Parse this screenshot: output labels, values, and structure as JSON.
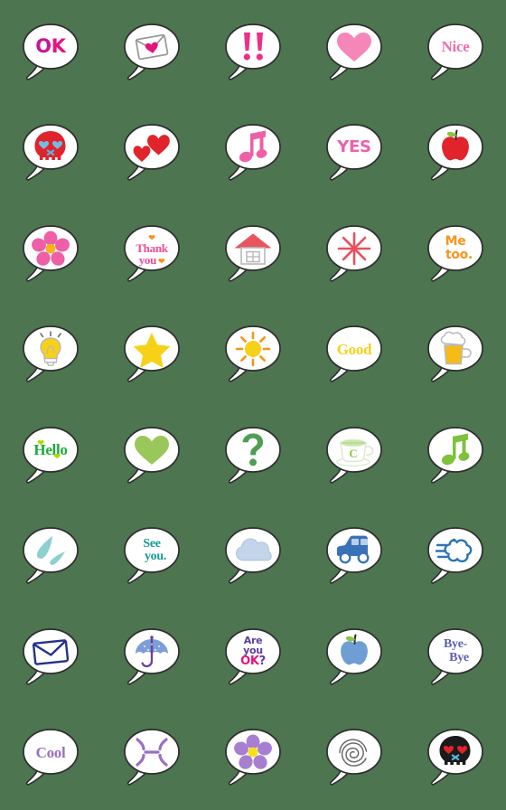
{
  "page": {
    "title": "Speech Bubble Emoji Sticker Set",
    "background_color": "#4c7550",
    "bubble_fill": "#ffffff",
    "bubble_outline": "#3a3a3a",
    "columns": 5,
    "rows": 8,
    "total_items": 40
  },
  "palette": {
    "magenta": "#c2189f",
    "pink": "#ee5fa7",
    "pink_light": "#f06eaa",
    "red": "#e1232b",
    "orange": "#f7941e",
    "yellow": "#f7d117",
    "green": "#1eaa39",
    "green_light": "#9ac75a",
    "green_apple": "#8cc63f",
    "teal": "#149b92",
    "teal_light": "#8ecfd0",
    "blue": "#3a72b8",
    "navy": "#23318c",
    "purple": "#9b6fc0",
    "violet": "#5b3fa0",
    "indigo": "#5b5fb0",
    "gray": "#9a9a9a",
    "black": "#1b1b1b"
  },
  "items": [
    {
      "row": 1,
      "col": 1,
      "name": "ok-bubble",
      "kind": "text",
      "text": "OK",
      "color": "#c2189f",
      "style": "lbl-ok"
    },
    {
      "row": 1,
      "col": 2,
      "name": "envelope-heart-bubble",
      "kind": "icon",
      "icon": "envelope-heart-icon",
      "color": "#9a9a9a",
      "accent": "#e4147d"
    },
    {
      "row": 1,
      "col": 3,
      "name": "double-exclamation-bubble",
      "kind": "icon",
      "icon": "double-exclamation-icon",
      "color": "#ee2e8a"
    },
    {
      "row": 1,
      "col": 4,
      "name": "pink-heart-bubble",
      "kind": "icon",
      "icon": "heart-icon",
      "color": "#f586b8"
    },
    {
      "row": 1,
      "col": 5,
      "name": "nice-bubble",
      "kind": "text",
      "text": "Nice",
      "color": "#f06eaa",
      "style": "lbl-nice"
    },
    {
      "row": 2,
      "col": 1,
      "name": "red-skull-bubble",
      "kind": "icon",
      "icon": "skull-heart-eyes-icon",
      "color": "#e1232b",
      "accent": "#6fbde0"
    },
    {
      "row": 2,
      "col": 2,
      "name": "two-hearts-bubble",
      "kind": "icon",
      "icon": "two-hearts-icon",
      "color": "#e1232b"
    },
    {
      "row": 2,
      "col": 3,
      "name": "pink-music-note-bubble",
      "kind": "icon",
      "icon": "music-note-icon",
      "color": "#ee5fa7"
    },
    {
      "row": 2,
      "col": 4,
      "name": "yes-bubble",
      "kind": "text",
      "text": "YES",
      "color": "#ee5fa7",
      "style": "lbl-yes"
    },
    {
      "row": 2,
      "col": 5,
      "name": "red-apple-bubble",
      "kind": "icon",
      "icon": "apple-icon",
      "color": "#e1232b",
      "accent": "#8cc63f"
    },
    {
      "row": 3,
      "col": 1,
      "name": "pink-flower-bubble",
      "kind": "icon",
      "icon": "flower-icon",
      "color": "#ee5fa7",
      "accent": "#f7b21e"
    },
    {
      "row": 3,
      "col": 2,
      "name": "thank-you-bubble",
      "kind": "text",
      "text": "Thank\nyou",
      "line1": "Thank",
      "line2": "you",
      "color": "#ef4a96",
      "style": "lbl-thank"
    },
    {
      "row": 3,
      "col": 3,
      "name": "house-bubble",
      "kind": "icon",
      "icon": "house-icon",
      "color": "#e8555f",
      "accent": "#b8b8b8"
    },
    {
      "row": 3,
      "col": 4,
      "name": "red-sparkle-bubble",
      "kind": "icon",
      "icon": "asterisk-sparkle-icon",
      "color": "#e8505c"
    },
    {
      "row": 3,
      "col": 5,
      "name": "me-too-bubble",
      "kind": "text",
      "line1": "Me",
      "line2": "too.",
      "color": "#f7941e",
      "style": "lbl-metoo"
    },
    {
      "row": 4,
      "col": 1,
      "name": "lightbulb-bubble",
      "kind": "icon",
      "icon": "lightbulb-icon",
      "color": "#f7d117",
      "accent": "#b8b8b8"
    },
    {
      "row": 4,
      "col": 2,
      "name": "yellow-star-bubble",
      "kind": "icon",
      "icon": "star-icon",
      "color": "#f7d117"
    },
    {
      "row": 4,
      "col": 3,
      "name": "sun-bubble",
      "kind": "icon",
      "icon": "sun-icon",
      "color": "#f7941e",
      "accent": "#f7d117"
    },
    {
      "row": 4,
      "col": 4,
      "name": "good-bubble",
      "kind": "text",
      "text": "Good",
      "color": "#f7d117",
      "style": "lbl-good"
    },
    {
      "row": 4,
      "col": 5,
      "name": "beer-mug-bubble",
      "kind": "icon",
      "icon": "beer-mug-icon",
      "color": "#f7bb17",
      "accent": "#b8b8b8"
    },
    {
      "row": 5,
      "col": 1,
      "name": "hello-bubble",
      "kind": "text",
      "text": "Hello",
      "color": "#1eaa39",
      "style": "lbl-hello"
    },
    {
      "row": 5,
      "col": 2,
      "name": "green-heart-bubble",
      "kind": "icon",
      "icon": "heart-icon",
      "color": "#9ac75a"
    },
    {
      "row": 5,
      "col": 3,
      "name": "question-mark-bubble",
      "kind": "icon",
      "icon": "question-mark-icon",
      "color": "#4f9e52"
    },
    {
      "row": 5,
      "col": 4,
      "name": "teacup-bubble",
      "kind": "icon",
      "icon": "teacup-icon",
      "color": "#8cc63f",
      "accent": "#dfe8cf"
    },
    {
      "row": 5,
      "col": 5,
      "name": "green-music-note-bubble",
      "kind": "icon",
      "icon": "music-note-icon",
      "color": "#7ec13d"
    },
    {
      "row": 6,
      "col": 1,
      "name": "water-drops-bubble",
      "kind": "icon",
      "icon": "water-drops-icon",
      "color": "#8ecfd0"
    },
    {
      "row": 6,
      "col": 2,
      "name": "see-you-bubble",
      "kind": "text",
      "line1": "See",
      "line2": "you.",
      "color": "#149b92",
      "style": "lbl-seeyou"
    },
    {
      "row": 6,
      "col": 3,
      "name": "cloud-bubble",
      "kind": "icon",
      "icon": "cloud-icon",
      "color": "#c4d4ea"
    },
    {
      "row": 6,
      "col": 4,
      "name": "blue-car-bubble",
      "kind": "icon",
      "icon": "car-icon",
      "color": "#3a72b8",
      "accent": "#b9cfe6"
    },
    {
      "row": 6,
      "col": 5,
      "name": "wind-puff-bubble",
      "kind": "icon",
      "icon": "wind-puff-icon",
      "color": "#2c74b5"
    },
    {
      "row": 7,
      "col": 1,
      "name": "blue-envelope-bubble",
      "kind": "icon",
      "icon": "envelope-icon",
      "color": "#23318c"
    },
    {
      "row": 7,
      "col": 2,
      "name": "umbrella-bubble",
      "kind": "icon",
      "icon": "umbrella-icon",
      "color": "#7b9fd6",
      "accent": "#6b3fa0"
    },
    {
      "row": 7,
      "col": 3,
      "name": "are-you-ok-bubble",
      "kind": "text",
      "line1": "Are",
      "line2": "you",
      "line3": "OK",
      "line3_suffix": "?",
      "color": "#5b3fa0",
      "accent": "#e4147d",
      "style": "lbl-areyouok"
    },
    {
      "row": 7,
      "col": 4,
      "name": "blue-apple-bubble",
      "kind": "icon",
      "icon": "apple-icon",
      "color": "#6e9ed4",
      "accent": "#8cc63f"
    },
    {
      "row": 7,
      "col": 5,
      "name": "bye-bye-bubble",
      "kind": "text",
      "line1": "Bye-",
      "line2": "Bye",
      "color": "#5b5fb0",
      "style": "lbl-byebye"
    },
    {
      "row": 8,
      "col": 1,
      "name": "cool-bubble",
      "kind": "text",
      "text": "Cool",
      "color": "#9b6fc0",
      "style": "lbl-cool"
    },
    {
      "row": 8,
      "col": 2,
      "name": "purple-sparkle-bubble",
      "kind": "icon",
      "icon": "sparkle-x-icon",
      "color": "#9b6fc0"
    },
    {
      "row": 8,
      "col": 3,
      "name": "purple-flower-bubble",
      "kind": "icon",
      "icon": "flower-icon",
      "color": "#a87fd0",
      "accent": "#f7e017"
    },
    {
      "row": 8,
      "col": 4,
      "name": "scribble-bubble",
      "kind": "icon",
      "icon": "scribble-icon",
      "color": "#6b6b6b"
    },
    {
      "row": 8,
      "col": 5,
      "name": "black-skull-bubble",
      "kind": "icon",
      "icon": "skull-heart-eyes-icon",
      "color": "#1b1b1b",
      "accent": "#e1232b"
    }
  ]
}
